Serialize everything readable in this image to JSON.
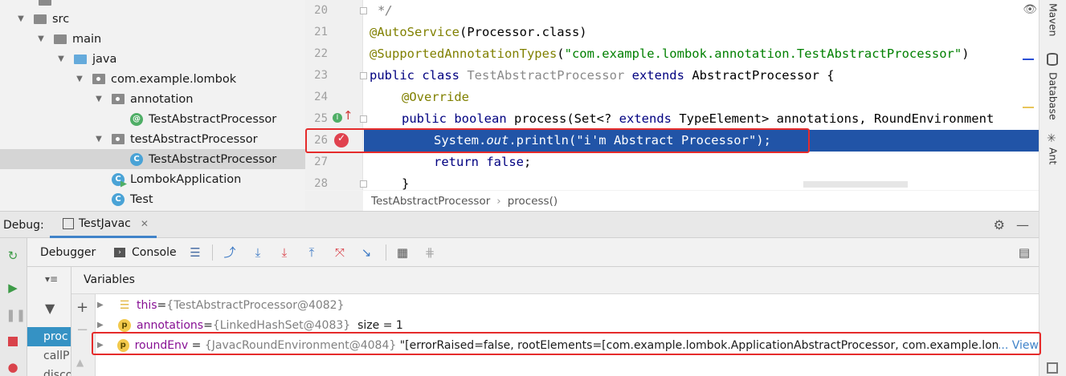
{
  "project_tree": {
    "items": [
      {
        "label": "src",
        "indent": 1,
        "icon": "folder-icon"
      },
      {
        "label": "main",
        "indent": 2,
        "icon": "folder-icon"
      },
      {
        "label": "java",
        "indent": 3,
        "icon": "folder-blue-icon"
      },
      {
        "label": "com.example.lombok",
        "indent": 4,
        "icon": "package-icon"
      },
      {
        "label": "annotation",
        "indent": 5,
        "icon": "package-icon"
      },
      {
        "label": "TestAbstractProcessor",
        "indent": 6,
        "icon": "annotation-icon"
      },
      {
        "label": "testAbstractProcessor",
        "indent": 5,
        "icon": "package-icon"
      },
      {
        "label": "TestAbstractProcessor",
        "indent": 6,
        "icon": "class-icon"
      },
      {
        "label": "LombokApplication",
        "indent": 5,
        "icon": "app-class-icon"
      },
      {
        "label": "Test",
        "indent": 5,
        "icon": "class-icon"
      }
    ]
  },
  "editor": {
    "line_numbers": [
      "20",
      "21",
      "22",
      "23",
      "24",
      "25",
      "26",
      "27",
      "28"
    ],
    "lines": {
      "l20": "*/",
      "l21_ann": "@AutoService",
      "l21_rest": "(Processor.class)",
      "l22_ann": "@SupportedAnnotationTypes",
      "l22_open": "(",
      "l22_str": "\"com.example.lombok.annotation.TestAbstractProcessor\"",
      "l22_close": ")",
      "l23_kw": "public class",
      "l23_name": "TestAbstractProcessor",
      "l23_kw2": "extends",
      "l23_rest": "AbstractProcessor {",
      "l24_ann": "@Override",
      "l25_kw": "public boolean",
      "l25_rest1": "process(Set<?",
      "l25_kw2": "extends",
      "l25_rest2": "TypeElement> annotations, RoundEnvironment",
      "l26_a": "System.",
      "l26_out": "out",
      "l26_b": ".println(\"i'm Abstract Processor\");",
      "l27_kw": "return false",
      "l27_rest": ";",
      "l28": "}"
    },
    "breadcrumb": [
      "TestAbstractProcessor",
      "process()"
    ]
  },
  "right_sidebar": {
    "tabs": [
      "Maven",
      "Database",
      "Ant"
    ]
  },
  "debug": {
    "label": "Debug:",
    "tab": "TestJavac",
    "toolbar": {
      "debugger_label": "Debugger",
      "console_label": "Console"
    },
    "frames": [
      "proc",
      "callP",
      "disco"
    ],
    "variables_title": "Variables",
    "variables": [
      {
        "name": "this",
        "eq": " = ",
        "value": "{TestAbstractProcessor@4082}",
        "extra": "",
        "link": ""
      },
      {
        "name": "annotations",
        "eq": " = ",
        "value": "{LinkedHashSet@4083}",
        "extra": "  size = 1",
        "link": ""
      },
      {
        "name": "roundEnv",
        "eq": " = ",
        "value": "{JavacRoundEnvironment@4084}",
        "extra": " \"[errorRaised=false, rootElements=[com.example.lombok.ApplicationAbstractProcessor, com.example.lombok.Lon",
        "link": "... View"
      }
    ]
  }
}
